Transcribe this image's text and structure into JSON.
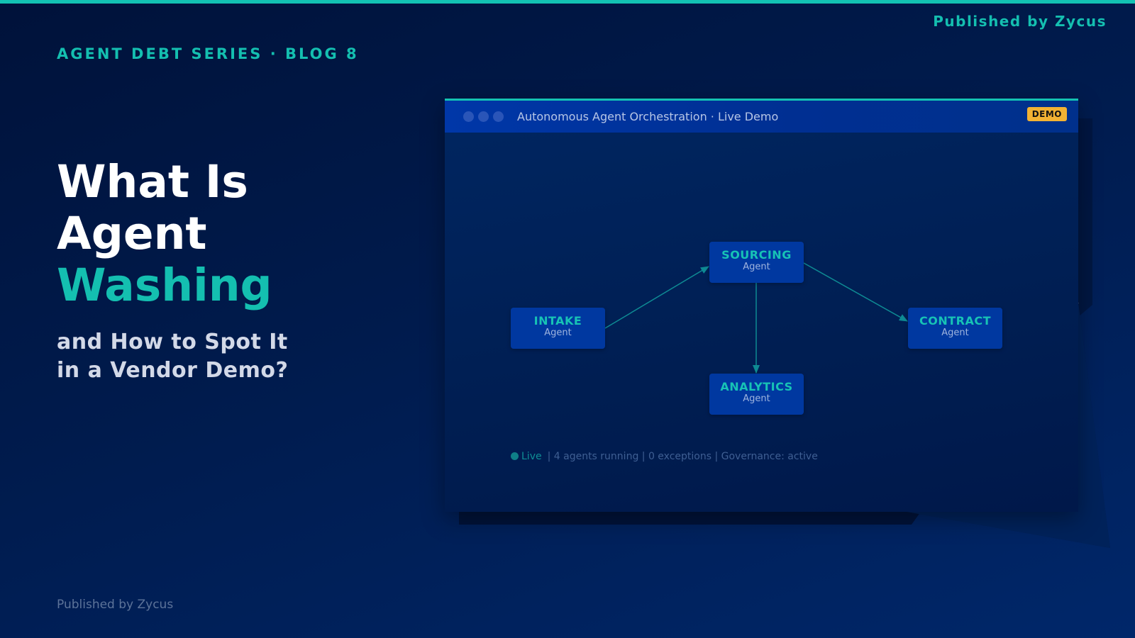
{
  "header": {
    "publisher": "Published by Zycus",
    "series_label": "AGENT DEBT SERIES · BLOG 8"
  },
  "hero": {
    "title_line_1": "What Is",
    "title_line_2": "Agent",
    "title_accent": "Washing",
    "subtitle_line_1": "and How to Spot It",
    "subtitle_line_2": "in a Vendor Demo?"
  },
  "footer": {
    "publisher": "Published by Zycus"
  },
  "demo_window": {
    "title": "Autonomous Agent Orchestration · Live Demo",
    "badge": "DEMO",
    "agents": [
      {
        "name": "SOURCING",
        "role": "Agent"
      },
      {
        "name": "INTAKE",
        "role": "Agent"
      },
      {
        "name": "CONTRACT",
        "role": "Agent"
      },
      {
        "name": "ANALYTICS",
        "role": "Agent"
      }
    ],
    "status": {
      "live_label": "Live",
      "details": "| 4 agents running | 0 exceptions | Governance: active"
    }
  },
  "colors": {
    "accent": "#14bfb0",
    "background_dark": "#00123a",
    "background_light": "#00276a",
    "node_fill": "#0038a0",
    "badge": "#f2b233"
  },
  "icons": {
    "window_controls": "window-control-dot-icon",
    "status_indicator": "live-status-dot-icon"
  }
}
